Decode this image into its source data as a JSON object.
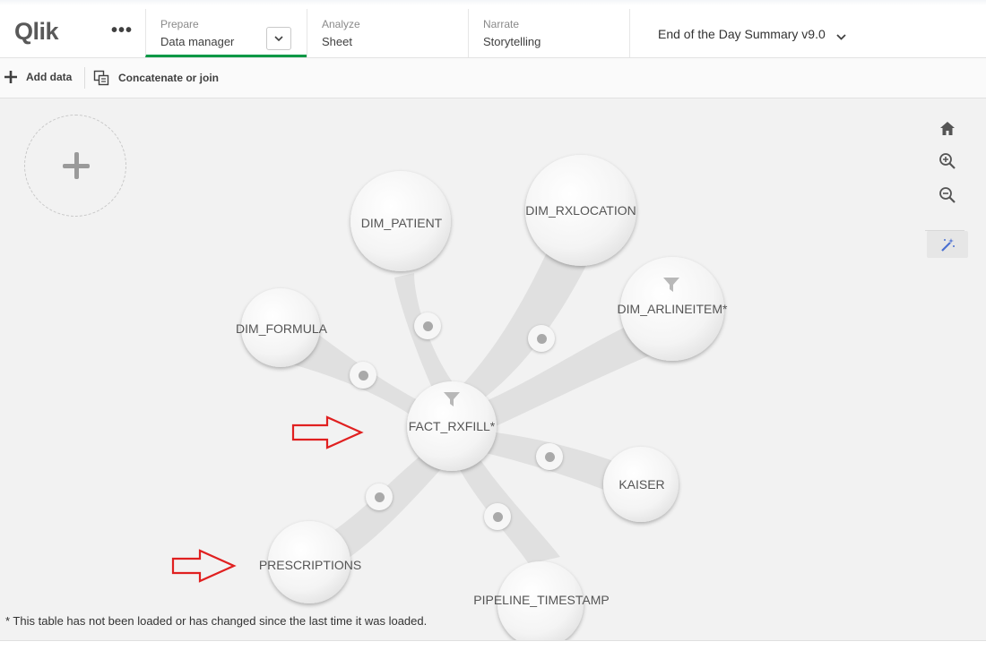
{
  "header": {
    "logo": "Qlik",
    "tabs": [
      {
        "small": "Prepare",
        "big": "Data manager"
      },
      {
        "small": "Analyze",
        "big": "Sheet"
      },
      {
        "small": "Narrate",
        "big": "Storytelling"
      }
    ],
    "app_title": "End of the Day Summary v9.0"
  },
  "toolbar": {
    "add_data": "Add data",
    "concatenate": "Concatenate or join"
  },
  "tables": [
    {
      "name": "DIM_PATIENT",
      "filtered": false
    },
    {
      "name": "DIM_RXLOCATION",
      "filtered": false
    },
    {
      "name": "DIM_ARLINEITEM*",
      "filtered": true
    },
    {
      "name": "DIM_FORMULA",
      "filtered": false
    },
    {
      "name": "FACT_RXFILL*",
      "filtered": true
    },
    {
      "name": "KAISER",
      "filtered": false
    },
    {
      "name": "PRESCRIPTIONS",
      "filtered": false
    },
    {
      "name": "PIPELINE_TIMESTAMP",
      "filtered": false
    }
  ],
  "footnote": "* This table has not been loaded or has changed since the last time it was loaded.",
  "icons": {
    "right_tools": [
      "home-icon",
      "zoom-in-icon",
      "zoom-out-icon",
      "magic-wand-icon"
    ],
    "annotation": "red-arrow-icon"
  },
  "colors": {
    "accent": "#009845",
    "annotation_arrow": "#e02020"
  }
}
